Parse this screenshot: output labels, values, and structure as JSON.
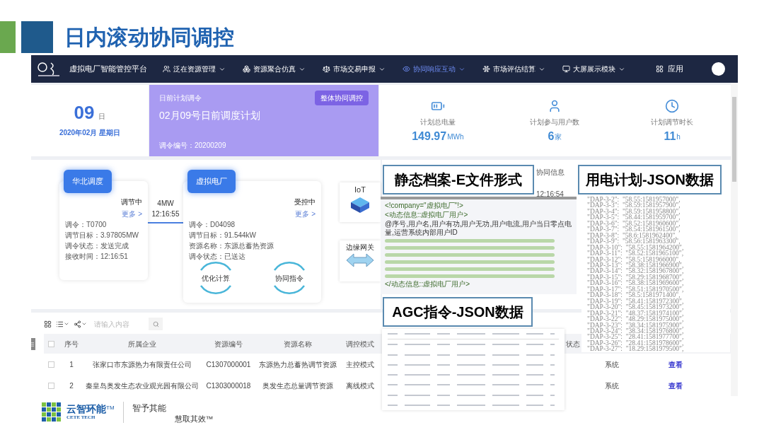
{
  "slide": {
    "title": "日内滚动协同调控"
  },
  "app": {
    "nav": {
      "title": "虚拟电厂智能管控平台",
      "apps_label": "应用",
      "menu": [
        {
          "label": "泛在资源管理",
          "selected": false
        },
        {
          "label": "资源聚合仿真",
          "selected": false
        },
        {
          "label": "市场交易申报",
          "selected": false
        },
        {
          "label": "协同响应互动",
          "selected": true
        },
        {
          "label": "市场评估结算",
          "selected": false
        },
        {
          "label": "大屏展示模块",
          "selected": false
        }
      ]
    },
    "date_card": {
      "day": "09",
      "day_unit": "日",
      "date": "2020年02月 星期日"
    },
    "plan_card": {
      "label": "日前计划调令",
      "title": "02月09号日前调度计划",
      "button": "整体协同调控",
      "code": "调令编号：20200209"
    },
    "stats": [
      {
        "label": "计划总电量",
        "value": "149.97",
        "unit": "MWh"
      },
      {
        "label": "计划参与用户数",
        "value": "6",
        "unit": "家"
      },
      {
        "label": "计划调节时长",
        "value": "11",
        "unit": "h"
      }
    ],
    "diagram": {
      "dispatch": {
        "title": "华北调度",
        "status": "调节中",
        "more": "更多 >",
        "fields": [
          "调令：T0700",
          "调节目标：3.97805MW",
          "调令状态：发送完成",
          "接收时间：12:16:51"
        ]
      },
      "link": {
        "power": "4MW",
        "time": "12:16:55"
      },
      "plant": {
        "title": "虚拟电厂",
        "status": "受控中",
        "more": "更多 >",
        "fields": [
          "调令：D04098",
          "调节目标：91.544kW",
          "资源名称：东源总蓄热资源",
          "调令状态：已送达"
        ],
        "steps": [
          "优化计算",
          "协同指令"
        ]
      },
      "iot": "IoT",
      "gateway": "边缘网关"
    },
    "coop": {
      "title": "协同信息",
      "time": "12:16:54"
    },
    "table": {
      "search_placeholder": "请输入内容",
      "select_all_checked": false,
      "columns": [
        "序号",
        "所属企业",
        "资源编号",
        "资源名称",
        "调控模式",
        "状态"
      ],
      "rows": [
        {
          "checked": false,
          "cells": [
            "1",
            "张家口市东源热力有限责任公司",
            "C1307000001",
            "东源热力总蓄热调节资源",
            "主控模式"
          ],
          "source": "系统",
          "action": "查看"
        },
        {
          "checked": false,
          "cells": [
            "2",
            "秦皇岛奥发生态农业观光园有限公司",
            "C1303000018",
            "奥发生态总量调节资源",
            "离线模式"
          ],
          "source": "系统",
          "action": "查看"
        }
      ]
    }
  },
  "callouts": [
    {
      "kind": "efile",
      "label": "静态档案-E文件形式",
      "lines": [
        {
          "kind": "tag",
          "text": "<!company=\"虚拟电厂\"!>"
        },
        {
          "kind": "tag",
          "text": "<动态信息::虚拟电厂用户>"
        },
        {
          "kind": "text",
          "text": "@序号,用户名,用户有功,用户无功,用户电流,用户当日零点电量,运营系统内部用户ID"
        },
        {
          "kind": "blurred"
        },
        {
          "kind": "blurred"
        },
        {
          "kind": "blurred"
        },
        {
          "kind": "blurred"
        },
        {
          "kind": "blurred"
        },
        {
          "kind": "blurred"
        },
        {
          "kind": "tag",
          "text": "</动态信息::虚拟电厂用户>"
        }
      ]
    },
    {
      "kind": "json",
      "label": "用电计划-JSON数据",
      "lines": [
        "\"DAP-3-2\":  \"58.55:1581957000\",",
        "\"DAP-3-3\":  \"58.59:1581957900\",",
        "\"DAP-3-4\":  \"58.59:1581958800\",",
        "\"DAP-3-5\":  \"58.44:1581959700\",",
        "\"DAP-3-6\":  \"58.52:1581960600\",",
        "\"DAP-3-7\":  \"58.54:1581961500\",",
        "\"DAP-3-8\":  \"58.6:1581962400\",",
        "\"DAP-3-9\":  \"58.56:1581963300\",",
        "\"DAP-3-10\":  \"58.55:1581964200\",",
        "\"DAP-3-11\":  \"58.52:1581965100\",",
        "\"DAP-3-12\":  \"58.5:1581966000\",",
        "\"DAP-3-13\":  \"58.38:1581966900\",",
        "\"DAP-3-14\":  \"58.32:1581967800\",",
        "\"DAP-3-15\":  \"58.29:1581968700\",",
        "\"DAP-3-16\":  \"58.38:1581969600\",",
        "\"DAP-3-17\":  \"58.51:1581970500\",",
        "\"DAP-3-18\":  \"58.5:1581971400\",",
        "\"DAP-3-19\":  \"58.41:1581972300\",",
        "\"DAP-3-20\":  \"58.45:1581973200\",",
        "\"DAP-3-21\":  \"48.37:1581974100\",",
        "\"DAP-3-22\":  \"48.29:1581975000\",",
        "\"DAP-3-23\":  \"38.34:1581975900\",",
        "\"DAP-3-24\":  \"38.34:1581976800\",",
        "\"DAP-3-25\":  \"28.41:1581977700\",",
        "\"DAP-3-26\":  \"28.41:1581978600\",",
        "\"DAP-3-27\":  \"18.29:1581979500\","
      ]
    },
    {
      "kind": "agc",
      "label": "AGC指令-JSON数据"
    }
  ],
  "footer": {
    "brand": "云智环能",
    "brand_en": "CETE TECH",
    "tm": "TM",
    "slogan_1": "智予其能",
    "slogan_2": "慧取其效™"
  }
}
